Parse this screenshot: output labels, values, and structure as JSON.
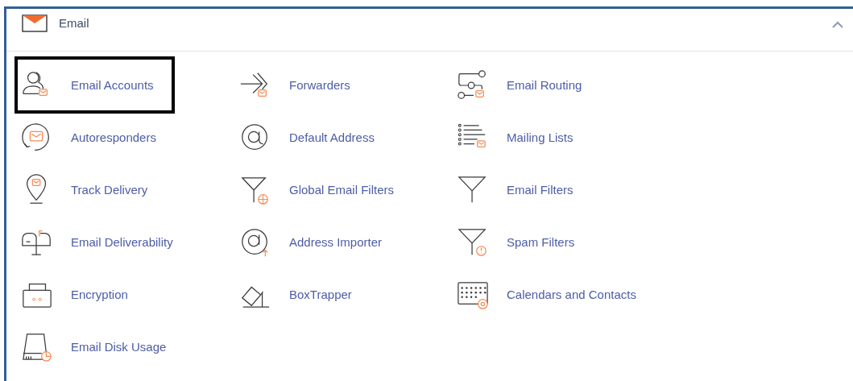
{
  "section": {
    "title": "Email",
    "expanded": true
  },
  "items": [
    {
      "label": "Email Accounts",
      "highlighted": true
    },
    {
      "label": "Forwarders",
      "highlighted": false
    },
    {
      "label": "Email Routing",
      "highlighted": false
    },
    {
      "label": "Autoresponders",
      "highlighted": false
    },
    {
      "label": "Default Address",
      "highlighted": false
    },
    {
      "label": "Mailing Lists",
      "highlighted": false
    },
    {
      "label": "Track Delivery",
      "highlighted": false
    },
    {
      "label": "Global Email Filters",
      "highlighted": false
    },
    {
      "label": "Email Filters",
      "highlighted": false
    },
    {
      "label": "Email Deliverability",
      "highlighted": false
    },
    {
      "label": "Address Importer",
      "highlighted": false
    },
    {
      "label": "Spam Filters",
      "highlighted": false
    },
    {
      "label": "Encryption",
      "highlighted": false
    },
    {
      "label": "BoxTrapper",
      "highlighted": false
    },
    {
      "label": "Calendars and Contacts",
      "highlighted": false
    },
    {
      "label": "Email Disk Usage",
      "highlighted": false
    }
  ]
}
